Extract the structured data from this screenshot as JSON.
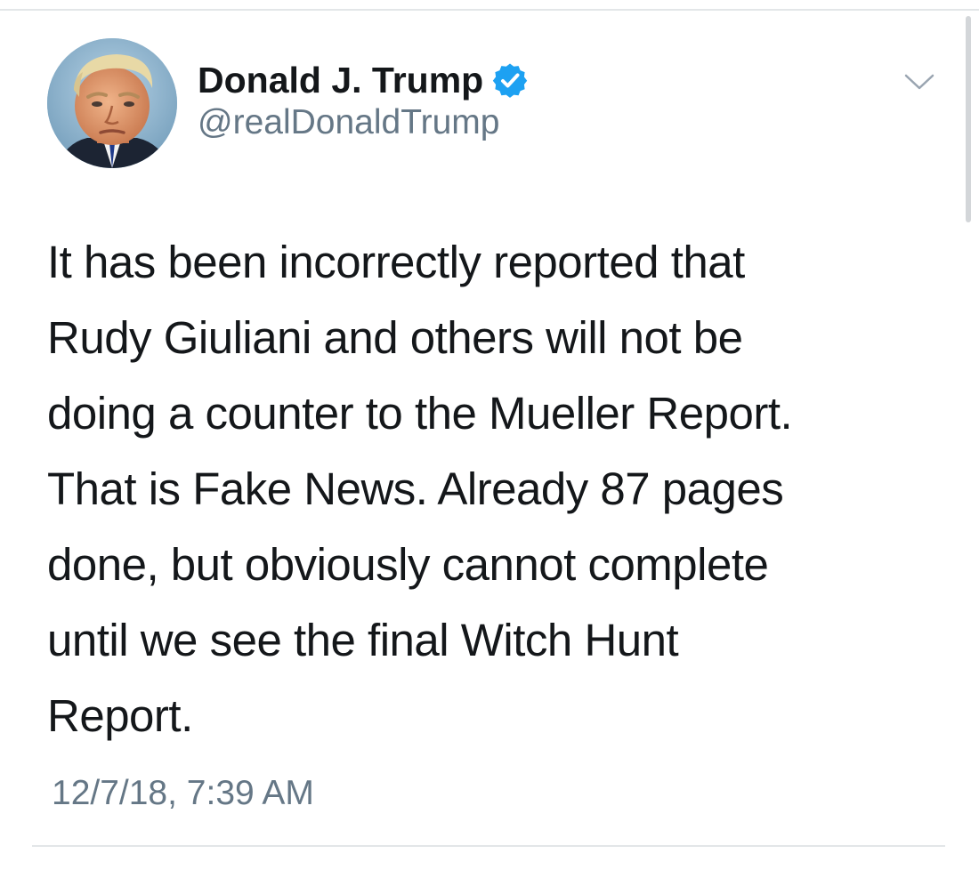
{
  "tweet": {
    "author": {
      "display_name": "Donald J. Trump",
      "handle": "@realDonaldTrump",
      "verified": true,
      "avatar_icon": "profile-photo"
    },
    "text_lines": [
      "It has been incorrectly reported that",
      "Rudy Giuliani and others will not be",
      "doing a counter to the Mueller Report.",
      "That is Fake News. Already 87 pages",
      "done, but obviously cannot complete",
      "until we see the final Witch Hunt",
      "Report."
    ],
    "timestamp": "12/7/18, 7:39 AM",
    "menu_icon": "chevron-down-icon"
  },
  "colors": {
    "primary_text": "#14171a",
    "secondary_text": "#657786",
    "verified_blue": "#1da1f2",
    "divider": "#e3e6e8",
    "background": "#ffffff"
  }
}
